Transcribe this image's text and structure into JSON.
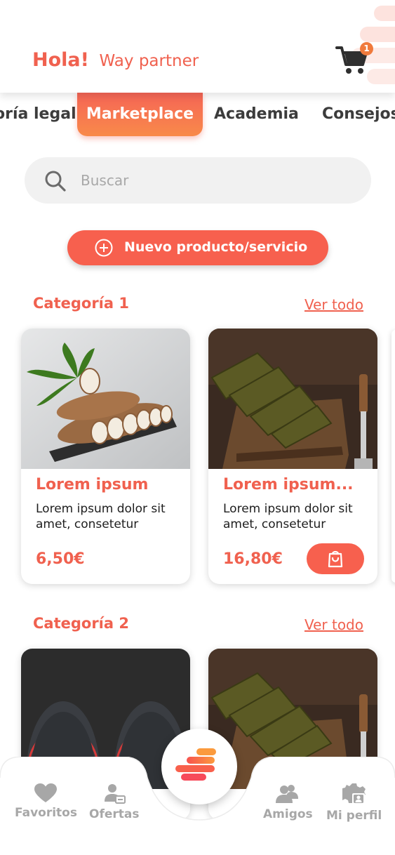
{
  "header": {
    "greeting_bold": "Hola!",
    "greeting_sub": "Way partner",
    "cart_count": "1"
  },
  "tabs": [
    {
      "label": "oría legal"
    },
    {
      "label": "Marketplace",
      "active": true
    },
    {
      "label": "Academia"
    },
    {
      "label": "Consejos"
    }
  ],
  "search": {
    "placeholder": "Buscar"
  },
  "new_button": {
    "label": "Nuevo producto/servicio"
  },
  "categories": [
    {
      "title": "Categoría 1",
      "see_all": "Ver todo",
      "products": [
        {
          "title": "Lorem ipsum",
          "description": "Lorem ipsum dolor sit amet, consetetur",
          "price": "6,50€"
        },
        {
          "title": "Lorem ipsum...",
          "description": "Lorem ipsum dolor sit amet, consetetur",
          "price": "16,80€"
        }
      ]
    },
    {
      "title": "Categoría 2",
      "see_all": "Ver todo"
    }
  ],
  "bottom_nav": {
    "items": [
      {
        "label": "Favoritos",
        "icon": "heart-icon"
      },
      {
        "label": "Ofertas",
        "icon": "offers-icon"
      },
      {
        "label": "Amigos",
        "icon": "friends-icon"
      },
      {
        "label": "Mi perfil",
        "icon": "profile-icon"
      }
    ]
  },
  "colors": {
    "accent": "#f0614f",
    "accent_gradient_end": "#f88a4a",
    "nav_gray": "#a7a7a7"
  }
}
